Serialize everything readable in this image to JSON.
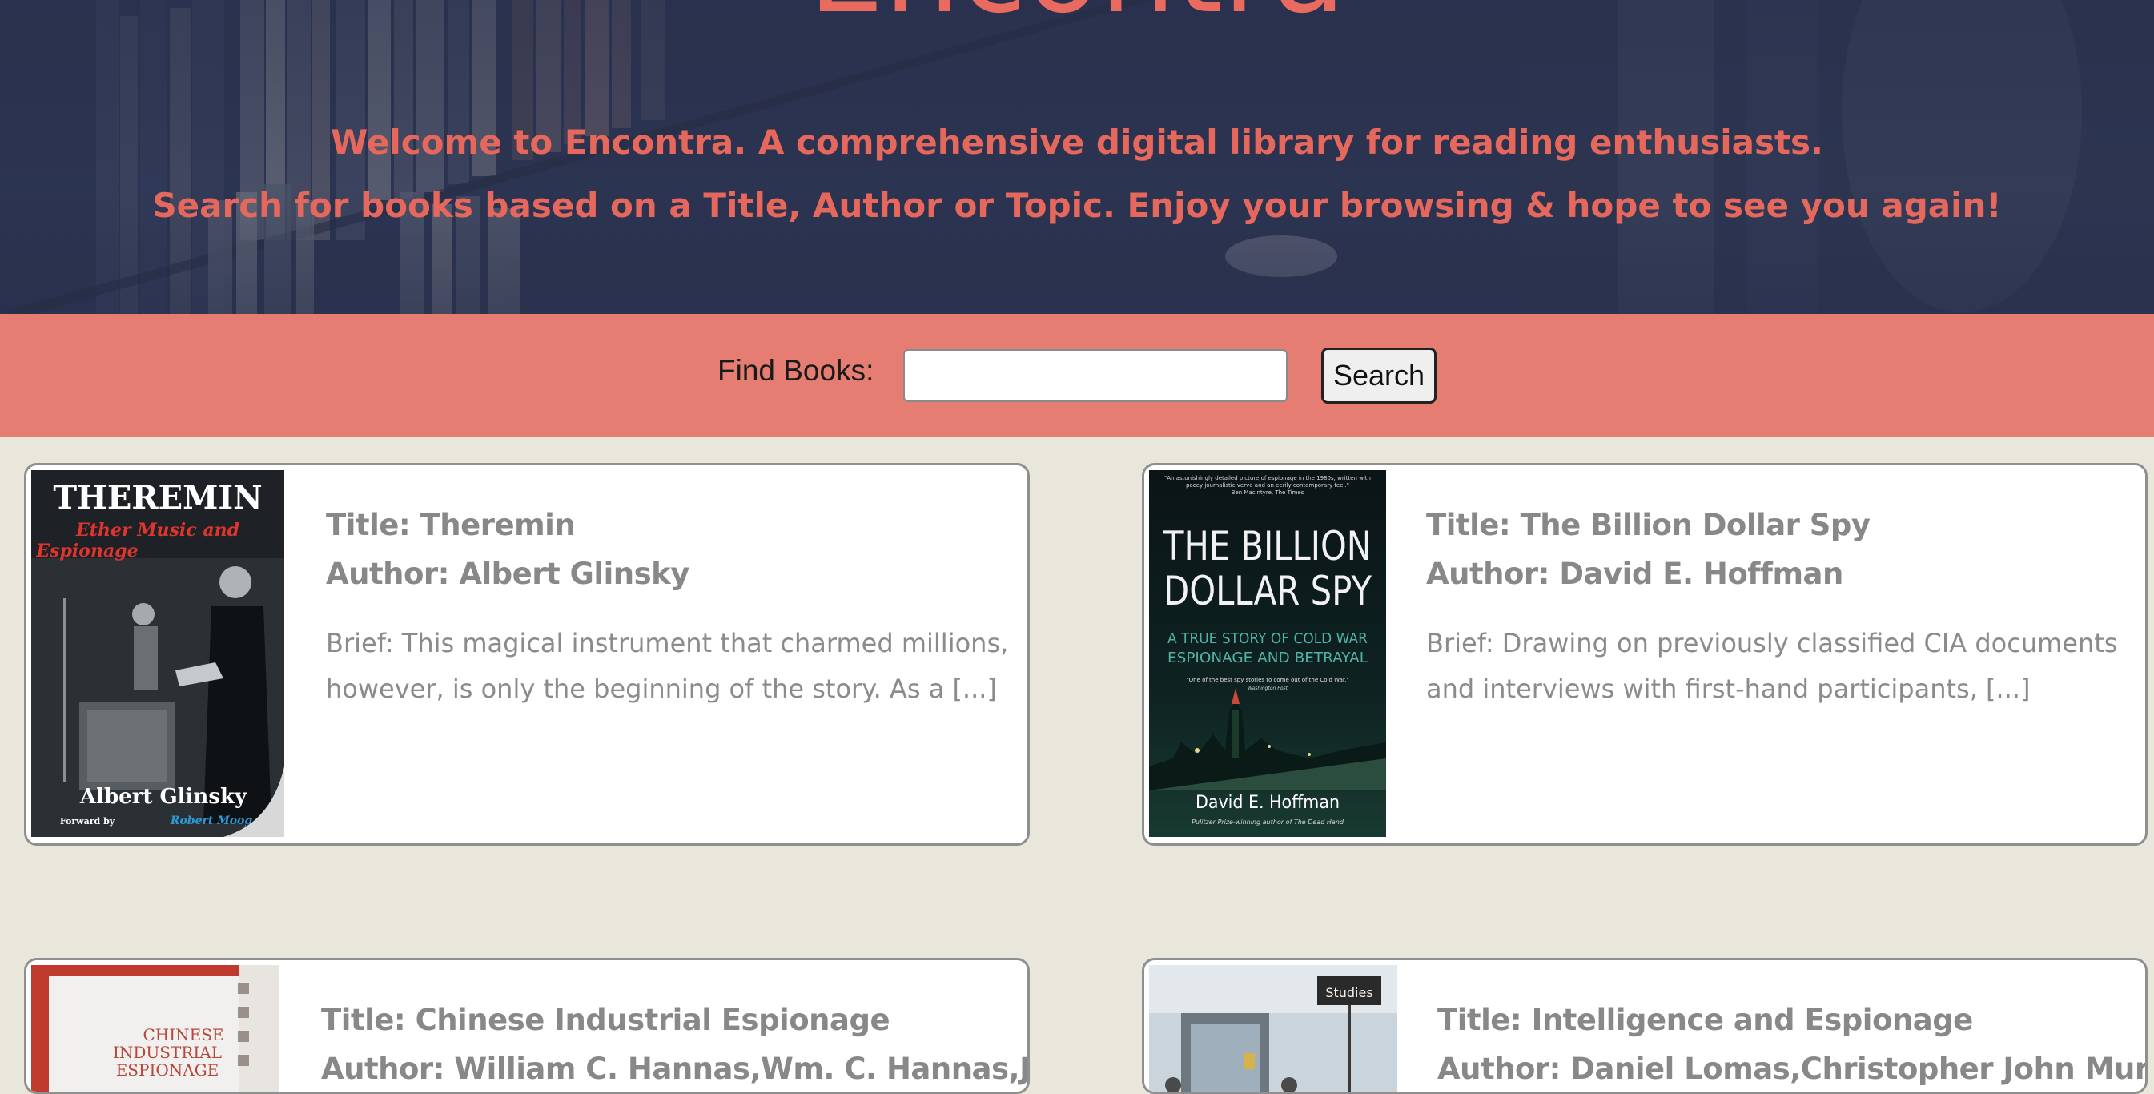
{
  "hero": {
    "site_title": "Encontra",
    "welcome_line1": "Welcome to Encontra. A comprehensive digital library for reading enthusiasts.",
    "welcome_line2": "Search for books based on a Title, Author or Topic. Enjoy your browsing & hope to see you again!"
  },
  "search": {
    "label": "Find Books:",
    "value": "",
    "placeholder": "",
    "button_label": "Search"
  },
  "books": [
    {
      "title": "Title: Theremin",
      "author": "Author: Albert Glinsky",
      "brief": "Brief: This magical instrument that charmed millions, however, is only the beginning of the story. As a [...]",
      "cover": {
        "title": "THEREMIN",
        "subtitle": "Ether Music and Espionage",
        "author": "Albert Glinsky",
        "foreword": "Forward by",
        "foreword_name": "Robert Moog"
      }
    },
    {
      "title": "Title: The Billion Dollar Spy",
      "author": "Author: David E. Hoffman",
      "brief": "Brief: Drawing on previously classified CIA documents and interviews with first-hand participants, [...]",
      "cover": {
        "quote": "\"An astonishingly detailed picture of espionage in the 1980s, written with pacey journalistic verve and an eerily contemporary feel.\"",
        "quote_source": "Ben Macintyre, The Times",
        "title_line1": "THE BILLION",
        "title_line2": "DOLLAR SPY",
        "subtitle_line1": "A TRUE STORY OF COLD WAR",
        "subtitle_line2": "ESPIONAGE AND BETRAYAL",
        "blurb": "\"One of the best spy stories to come out of the Cold War.\"",
        "blurb_source": "Washington Post",
        "author": "David E. Hoffman",
        "tagline": "Pulitzer Prize-winning author of The Dead Hand"
      }
    },
    {
      "title": "Title: Chinese Industrial Espionage",
      "author": "Author: William C. Hannas,Wm. C. Hannas,James",
      "cover": {
        "line1": "CHINESE",
        "line2": "INDUSTRIAL",
        "line3": "ESPIONAGE"
      }
    },
    {
      "title": "Title: Intelligence and Espionage",
      "author": "Author: Daniel Lomas,Christopher John Murphy",
      "cover": {
        "sign": "Studies"
      }
    }
  ],
  "colors": {
    "hero_bg": "#2c3450",
    "accent": "#e6685c",
    "search_bar": "#e67d72",
    "page_bg": "#e9e7dc",
    "card_text": "#888888"
  }
}
